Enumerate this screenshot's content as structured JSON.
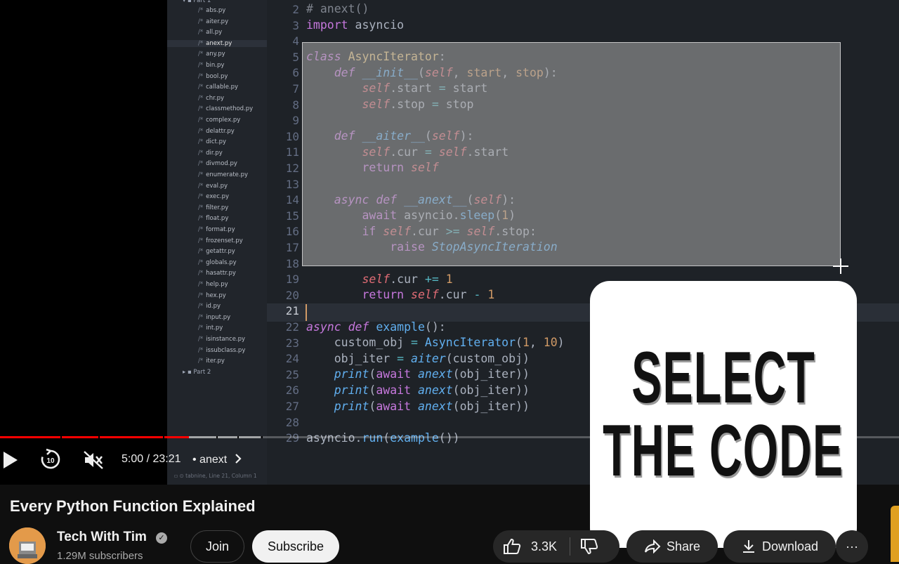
{
  "file_tree": {
    "folder_open": "Part 1",
    "files": [
      "abs.py",
      "aiter.py",
      "all.py",
      "anext.py",
      "any.py",
      "bin.py",
      "bool.py",
      "callable.py",
      "chr.py",
      "classmethod.py",
      "complex.py",
      "delattr.py",
      "dict.py",
      "dir.py",
      "divmod.py",
      "enumerate.py",
      "eval.py",
      "exec.py",
      "filter.py",
      "float.py",
      "format.py",
      "frozenset.py",
      "getattr.py",
      "globals.py",
      "hasattr.py",
      "help.py",
      "hex.py",
      "id.py",
      "input.py",
      "int.py",
      "isinstance.py",
      "issubclass.py",
      "iter.py"
    ],
    "file_prefix": "/*",
    "active_file": "anext.py",
    "folder_closed": "Part 2",
    "status": "⊙ tabnine, Line 21, Column 1"
  },
  "code": {
    "line_numbers": [
      "2",
      "3",
      "4",
      "5",
      "6",
      "7",
      "8",
      "9",
      "10",
      "11",
      "12",
      "13",
      "14",
      "15",
      "16",
      "17",
      "18",
      "19",
      "20",
      "21",
      "22",
      "23",
      "24",
      "25",
      "26",
      "27",
      "28",
      "29"
    ],
    "current_line": "21"
  },
  "callout": {
    "line1": "SELECT",
    "line2": "THE CODE"
  },
  "player": {
    "progress_played": 0.21,
    "progress_buffered": 0.29,
    "time": "5:00 / 23:21",
    "chapter": "• anext",
    "icons": [
      "play-icon",
      "replay-10-icon",
      "muted-icon",
      "chevron-right-icon"
    ]
  },
  "video": {
    "title": "Every Python Function Explained",
    "channel": "Tech With Tim",
    "subscribers": "1.29M subscribers",
    "join": "Join",
    "subscribe": "Subscribe",
    "likes": "3.3K",
    "share": "Share",
    "download": "Download",
    "more": "···"
  },
  "colors": {
    "accent": "#ff0000",
    "editor_bg": "#1e2227",
    "callout_bg": "#ffffff"
  }
}
